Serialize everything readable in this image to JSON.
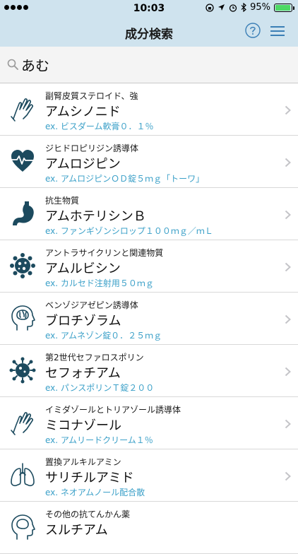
{
  "status": {
    "time": "10:03",
    "battery": "95%",
    "battery_level": 0.95
  },
  "nav": {
    "title": "成分検索",
    "help_icon": "question-circle-icon",
    "menu_icon": "hamburger-menu-icon"
  },
  "search": {
    "value": "あむ",
    "icon": "search-icon"
  },
  "rows": [
    {
      "category": "副腎皮質ステロイド、強",
      "name": "アムシノニド",
      "example": "ex. ビスダーム軟膏０．１％",
      "icon": "glove-hand-icon"
    },
    {
      "category": "ジヒドロピリジン誘導体",
      "name": "アムロジピン",
      "example": "ex. アムロジピンＯＤ錠５ｍｇ「トーワ」",
      "icon": "heart-pulse-icon"
    },
    {
      "category": "抗生物質",
      "name": "アムホテリシンＢ",
      "example": "ex. ファンギゾンシロップ１００ｍｇ／ｍＬ",
      "icon": "stomach-icon"
    },
    {
      "category": "アントラサイクリンと関連物質",
      "name": "アムルビシン",
      "example": "ex. カルセド注射用５０ｍｇ",
      "icon": "cancer-cell-icon"
    },
    {
      "category": "ベンゾジアゼピン誘導体",
      "name": "ブロチゾラム",
      "example": "ex. アムネゾン錠０．２５ｍｇ",
      "icon": "brain-head-icon"
    },
    {
      "category": "第2世代セファロスポリン",
      "name": "セフォチアム",
      "example": "ex. パンスポリンＴ錠２００",
      "icon": "virus-icon"
    },
    {
      "category": "イミダゾールとトリアゾール誘導体",
      "name": "ミコナゾール",
      "example": "ex. アムリードクリーム１％",
      "icon": "glove-hand-icon"
    },
    {
      "category": "置換アルキルアミン",
      "name": "サリチルアミド",
      "example": "ex. ネオアムノール配合散",
      "icon": "lungs-icon"
    },
    {
      "category": "その他の抗てんかん薬",
      "name": "スルチアム",
      "example": "",
      "icon": "brain-head-icon"
    }
  ],
  "colors": {
    "header_bg": "#cfe3ee",
    "accent": "#3ba0c8",
    "icon_dark": "#1c4a5e"
  }
}
